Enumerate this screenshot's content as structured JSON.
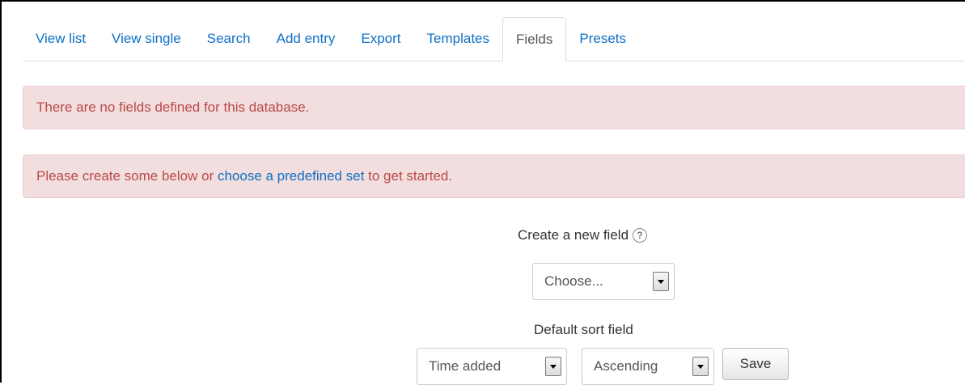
{
  "tabs": [
    {
      "label": "View list",
      "active": false
    },
    {
      "label": "View single",
      "active": false
    },
    {
      "label": "Search",
      "active": false
    },
    {
      "label": "Add entry",
      "active": false
    },
    {
      "label": "Export",
      "active": false
    },
    {
      "label": "Templates",
      "active": false
    },
    {
      "label": "Fields",
      "active": true
    },
    {
      "label": "Presets",
      "active": false
    }
  ],
  "alerts": {
    "no_fields": "There are no fields defined for this database.",
    "create_prefix": "Please create some below or ",
    "create_link": "choose a predefined set",
    "create_suffix": " to get started."
  },
  "create_field": {
    "label": "Create a new field",
    "help_icon": "question-circle-icon",
    "select_value": "Choose..."
  },
  "sort": {
    "label": "Default sort field",
    "field_value": "Time added",
    "order_value": "Ascending",
    "save_label": "Save"
  },
  "colors": {
    "link": "#0f6fc5",
    "alert_bg": "#f2dede",
    "alert_text": "#b94a48"
  }
}
